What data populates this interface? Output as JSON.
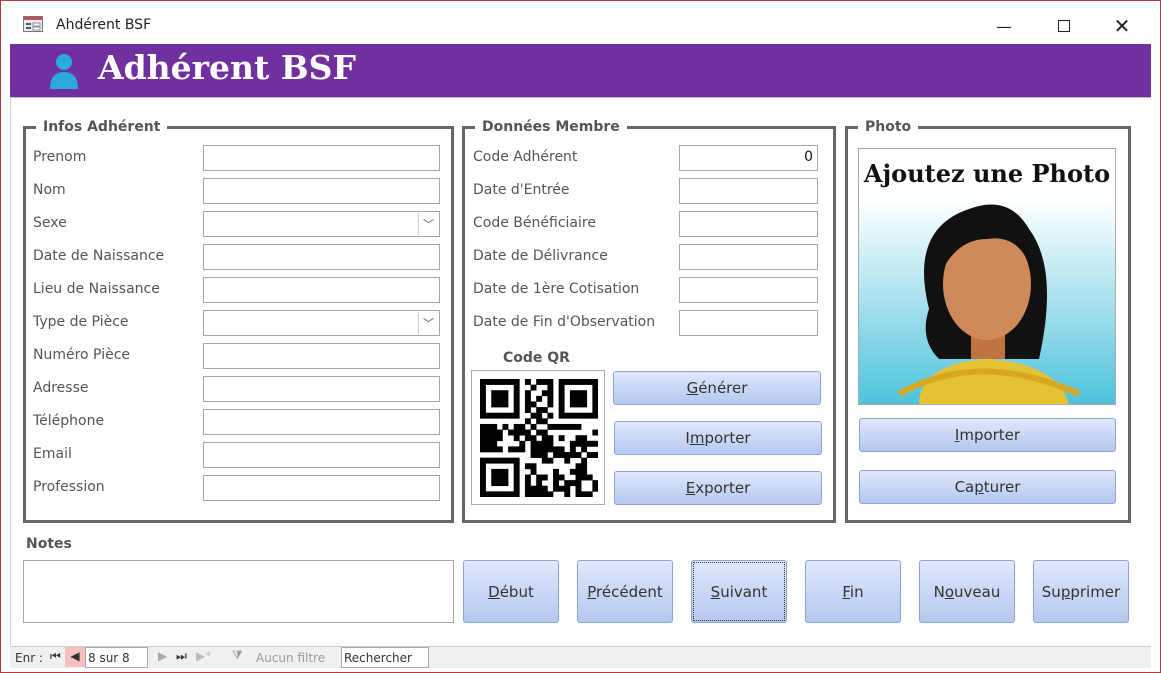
{
  "window": {
    "title": "Ahdérent BSF",
    "minimize_icon": "minimize-icon",
    "maximize_icon": "maximize-icon",
    "close_icon": "close-icon"
  },
  "header": {
    "title": "Adhérent BSF",
    "icon": "user-icon",
    "color": "#7030a0"
  },
  "infos": {
    "title": "Infos Adhérent",
    "fields": [
      {
        "label": "Prenom",
        "value": ""
      },
      {
        "label": "Nom",
        "value": ""
      },
      {
        "label": "Sexe",
        "value": "",
        "dropdown": true
      },
      {
        "label": "Date de Naissance",
        "value": ""
      },
      {
        "label": "Lieu de Naissance",
        "value": ""
      },
      {
        "label": "Type de Pièce",
        "value": "",
        "dropdown": true
      },
      {
        "label": "Numéro Pièce",
        "value": ""
      },
      {
        "label": "Adresse",
        "value": ""
      },
      {
        "label": "Téléphone",
        "value": ""
      },
      {
        "label": "Email",
        "value": ""
      },
      {
        "label": "Profession",
        "value": ""
      }
    ]
  },
  "donnees": {
    "title": "Données Membre",
    "fields": [
      {
        "label": "Code Adhérent",
        "value": "0"
      },
      {
        "label": "Date d'Entrée",
        "value": ""
      },
      {
        "label": "Code Bénéficiaire",
        "value": ""
      },
      {
        "label": "Date de Délivrance",
        "value": ""
      },
      {
        "label": "Date de 1ère Cotisation",
        "value": ""
      },
      {
        "label": "Date de Fin d'Observation",
        "value": ""
      }
    ],
    "qr_label": "Code QR",
    "buttons": [
      {
        "pre": "",
        "u": "G",
        "post": "énérer"
      },
      {
        "pre": "I",
        "u": "m",
        "post": "porter"
      },
      {
        "pre": "",
        "u": "E",
        "post": "xporter"
      }
    ]
  },
  "photo": {
    "title": "Photo",
    "caption": "Ajoutez une Photo",
    "buttons": [
      {
        "pre": "",
        "u": "I",
        "post": "mporter"
      },
      {
        "pre": "Ca",
        "u": "p",
        "post": "turer"
      }
    ]
  },
  "notes": {
    "label": "Notes",
    "value": ""
  },
  "nav": [
    {
      "pre": "",
      "u": "D",
      "post": "ébut"
    },
    {
      "pre": "",
      "u": "P",
      "post": "récédent"
    },
    {
      "pre": "",
      "u": "S",
      "post": "uivant"
    },
    {
      "pre": "",
      "u": "F",
      "post": "in"
    },
    {
      "pre": "N",
      "u": "o",
      "post": "uveau"
    },
    {
      "pre": "Su",
      "u": "p",
      "post": "primer"
    }
  ],
  "status": {
    "record_label": "Enr :",
    "record_value": "8 sur 8",
    "filter": "Aucun filtre",
    "search": "Rechercher"
  }
}
